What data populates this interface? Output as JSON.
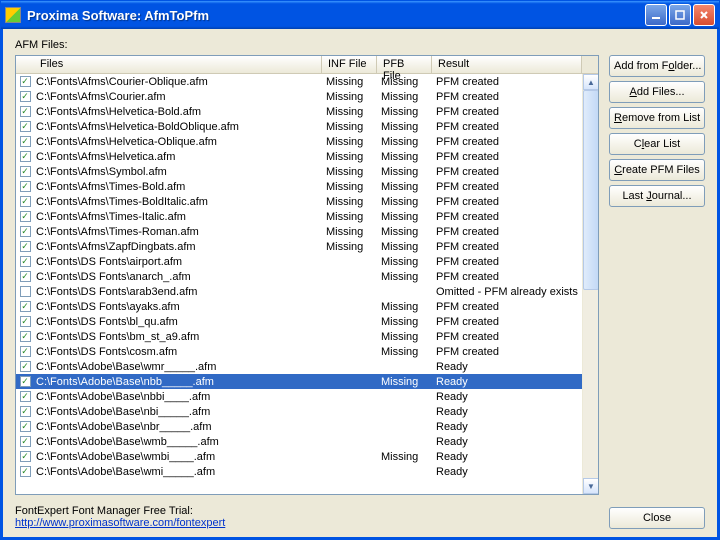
{
  "window": {
    "title": "Proxima Software: AfmToPfm"
  },
  "section_label": "AFM Files:",
  "columns": {
    "files": "Files",
    "inf": "INF File",
    "pfb": "PFB File",
    "result": "Result"
  },
  "rows": [
    {
      "checked": true,
      "file": "C:\\Fonts\\Afms\\Courier-Oblique.afm",
      "inf": "Missing",
      "pfb": "Missing",
      "result": "PFM created"
    },
    {
      "checked": true,
      "file": "C:\\Fonts\\Afms\\Courier.afm",
      "inf": "Missing",
      "pfb": "Missing",
      "result": "PFM created"
    },
    {
      "checked": true,
      "file": "C:\\Fonts\\Afms\\Helvetica-Bold.afm",
      "inf": "Missing",
      "pfb": "Missing",
      "result": "PFM created"
    },
    {
      "checked": true,
      "file": "C:\\Fonts\\Afms\\Helvetica-BoldOblique.afm",
      "inf": "Missing",
      "pfb": "Missing",
      "result": "PFM created"
    },
    {
      "checked": true,
      "file": "C:\\Fonts\\Afms\\Helvetica-Oblique.afm",
      "inf": "Missing",
      "pfb": "Missing",
      "result": "PFM created"
    },
    {
      "checked": true,
      "file": "C:\\Fonts\\Afms\\Helvetica.afm",
      "inf": "Missing",
      "pfb": "Missing",
      "result": "PFM created"
    },
    {
      "checked": true,
      "file": "C:\\Fonts\\Afms\\Symbol.afm",
      "inf": "Missing",
      "pfb": "Missing",
      "result": "PFM created"
    },
    {
      "checked": true,
      "file": "C:\\Fonts\\Afms\\Times-Bold.afm",
      "inf": "Missing",
      "pfb": "Missing",
      "result": "PFM created"
    },
    {
      "checked": true,
      "file": "C:\\Fonts\\Afms\\Times-BoldItalic.afm",
      "inf": "Missing",
      "pfb": "Missing",
      "result": "PFM created"
    },
    {
      "checked": true,
      "file": "C:\\Fonts\\Afms\\Times-Italic.afm",
      "inf": "Missing",
      "pfb": "Missing",
      "result": "PFM created"
    },
    {
      "checked": true,
      "file": "C:\\Fonts\\Afms\\Times-Roman.afm",
      "inf": "Missing",
      "pfb": "Missing",
      "result": "PFM created"
    },
    {
      "checked": true,
      "file": "C:\\Fonts\\Afms\\ZapfDingbats.afm",
      "inf": "Missing",
      "pfb": "Missing",
      "result": "PFM created"
    },
    {
      "checked": true,
      "file": "C:\\Fonts\\DS Fonts\\airport.afm",
      "inf": "",
      "pfb": "Missing",
      "result": "PFM created"
    },
    {
      "checked": true,
      "file": "C:\\Fonts\\DS Fonts\\anarch_.afm",
      "inf": "",
      "pfb": "Missing",
      "result": "PFM created"
    },
    {
      "checked": false,
      "file": "C:\\Fonts\\DS Fonts\\arab3end.afm",
      "inf": "",
      "pfb": "",
      "result": "Omitted - PFM already exists"
    },
    {
      "checked": true,
      "file": "C:\\Fonts\\DS Fonts\\ayaks.afm",
      "inf": "",
      "pfb": "Missing",
      "result": "PFM created"
    },
    {
      "checked": true,
      "file": "C:\\Fonts\\DS Fonts\\bl_qu.afm",
      "inf": "",
      "pfb": "Missing",
      "result": "PFM created"
    },
    {
      "checked": true,
      "file": "C:\\Fonts\\DS Fonts\\bm_st_a9.afm",
      "inf": "",
      "pfb": "Missing",
      "result": "PFM created"
    },
    {
      "checked": true,
      "file": "C:\\Fonts\\DS Fonts\\cosm.afm",
      "inf": "",
      "pfb": "Missing",
      "result": "PFM created"
    },
    {
      "checked": true,
      "file": "C:\\Fonts\\Adobe\\Base\\wmr_____.afm",
      "inf": "",
      "pfb": "",
      "result": "Ready"
    },
    {
      "checked": true,
      "file": "C:\\Fonts\\Adobe\\Base\\nbb_____.afm",
      "inf": "",
      "pfb": "Missing",
      "result": "Ready",
      "selected": true
    },
    {
      "checked": true,
      "file": "C:\\Fonts\\Adobe\\Base\\nbbi____.afm",
      "inf": "",
      "pfb": "",
      "result": "Ready"
    },
    {
      "checked": true,
      "file": "C:\\Fonts\\Adobe\\Base\\nbi_____.afm",
      "inf": "",
      "pfb": "",
      "result": "Ready"
    },
    {
      "checked": true,
      "file": "C:\\Fonts\\Adobe\\Base\\nbr_____.afm",
      "inf": "",
      "pfb": "",
      "result": "Ready"
    },
    {
      "checked": true,
      "file": "C:\\Fonts\\Adobe\\Base\\wmb_____.afm",
      "inf": "",
      "pfb": "",
      "result": "Ready"
    },
    {
      "checked": true,
      "file": "C:\\Fonts\\Adobe\\Base\\wmbi____.afm",
      "inf": "",
      "pfb": "Missing",
      "result": "Ready"
    },
    {
      "checked": true,
      "file": "C:\\Fonts\\Adobe\\Base\\wmi_____.afm",
      "inf": "",
      "pfb": "",
      "result": "Ready"
    }
  ],
  "buttons": {
    "add_folder": "Add from Folder...",
    "add_files": "Add Files...",
    "remove": "Remove from List",
    "clear": "Clear List",
    "create": "Create PFM Files",
    "journal": "Last Journal...",
    "close": "Close"
  },
  "footer": {
    "line1": "FontExpert Font Manager Free Trial:",
    "link_text": "http://www.proximasoftware.com/fontexpert"
  }
}
